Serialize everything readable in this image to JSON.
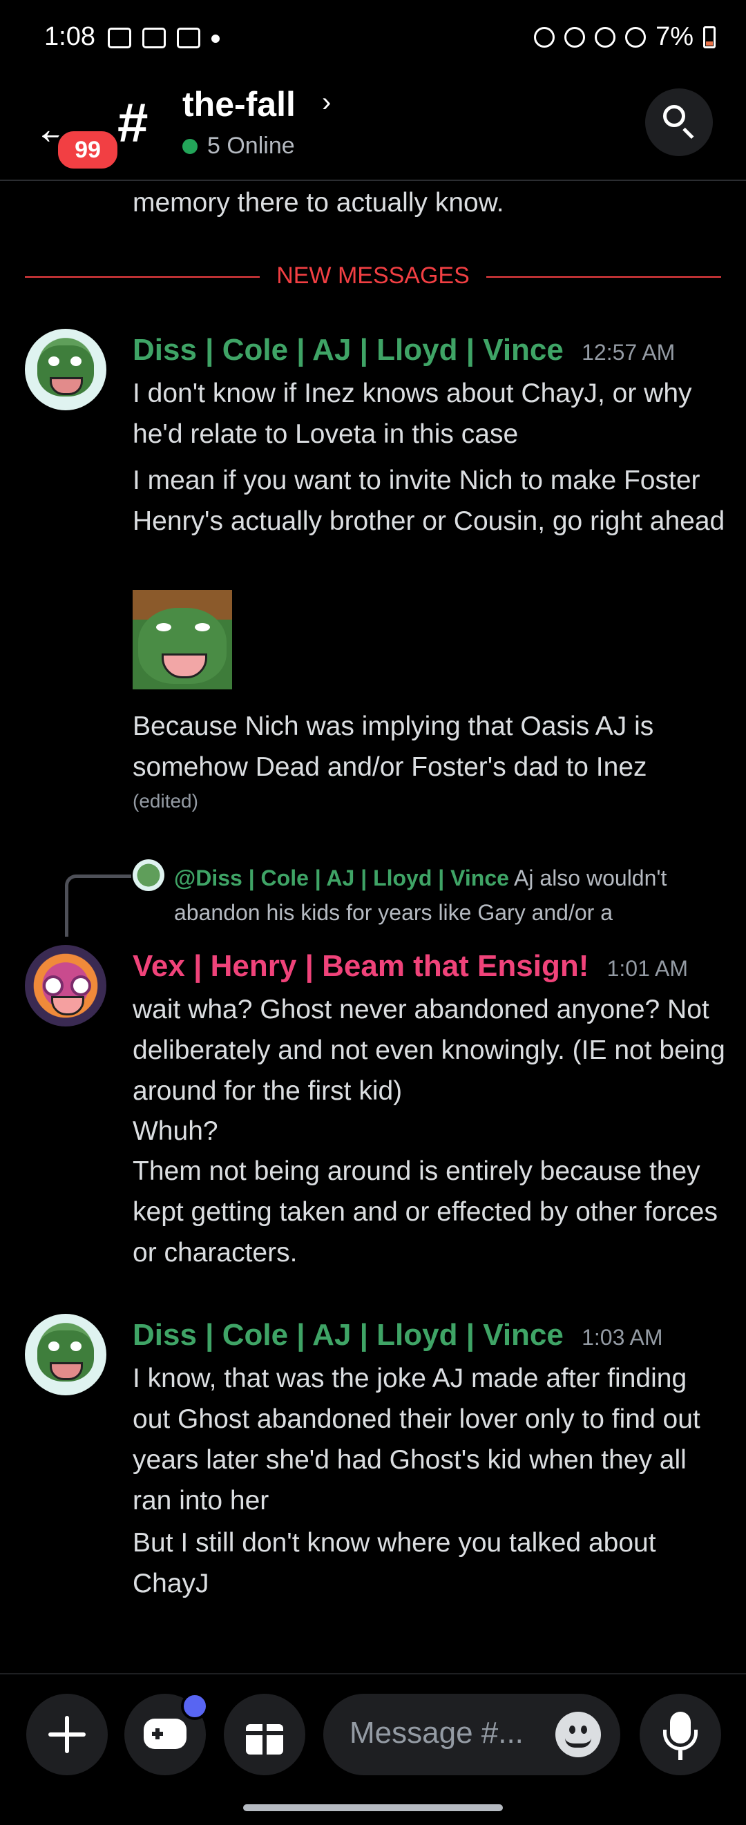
{
  "status_bar": {
    "time": "1:08",
    "battery": "7%"
  },
  "header": {
    "back_badge": "99",
    "channel_hash": "#",
    "channel_name": "the-fall",
    "chevron": "›",
    "online_text": "5 Online"
  },
  "messages": {
    "continued_text": "memory there to actually know.",
    "new_divider": "NEW MESSAGES",
    "group1": {
      "username": "Diss | Cole | AJ | Lloyd | Vince",
      "timestamp": "12:57 AM",
      "lines": [
        "I don't know if Inez knows about ChayJ, or why he'd relate to Loveta in this case",
        "I mean if you want to invite Nich to make Foster Henry's actually brother or Cousin, go right ahead",
        "Because Nich was implying that Oasis AJ is somehow Dead and/or Foster's dad to Inez"
      ],
      "edited": "(edited)"
    },
    "reply": {
      "mention": "@Diss | Cole | AJ | Lloyd | Vince",
      "preview": "Aj also wouldn't abandon his kids for years like Gary and/or a"
    },
    "group2": {
      "username": "Vex | Henry | Beam that Ensign!",
      "timestamp": "1:01 AM",
      "lines": [
        "wait wha? Ghost never abandoned anyone? Not deliberately and not even knowingly. (IE not being around for the first kid)",
        "Whuh?",
        "Them not being around is entirely because they kept getting taken and or effected by other forces or characters."
      ]
    },
    "group3": {
      "username": "Diss | Cole | AJ | Lloyd | Vince",
      "timestamp": "1:03 AM",
      "lines": [
        "I know, that was the joke AJ made after finding out Ghost abandoned their lover only to find out years later she'd had Ghost's kid when they all ran into her",
        "But I still don't know where you talked about ChayJ"
      ]
    }
  },
  "composer": {
    "placeholder": "Message #..."
  },
  "colors": {
    "accent_green": "#3fa466",
    "accent_pink": "#f0437a",
    "new_messages_red": "#f23f43",
    "online_dot": "#23a559"
  },
  "icons": [
    "back-arrow-icon",
    "search-icon",
    "plus-icon",
    "gamepad-icon",
    "gift-icon",
    "emoji-icon",
    "microphone-icon"
  ]
}
